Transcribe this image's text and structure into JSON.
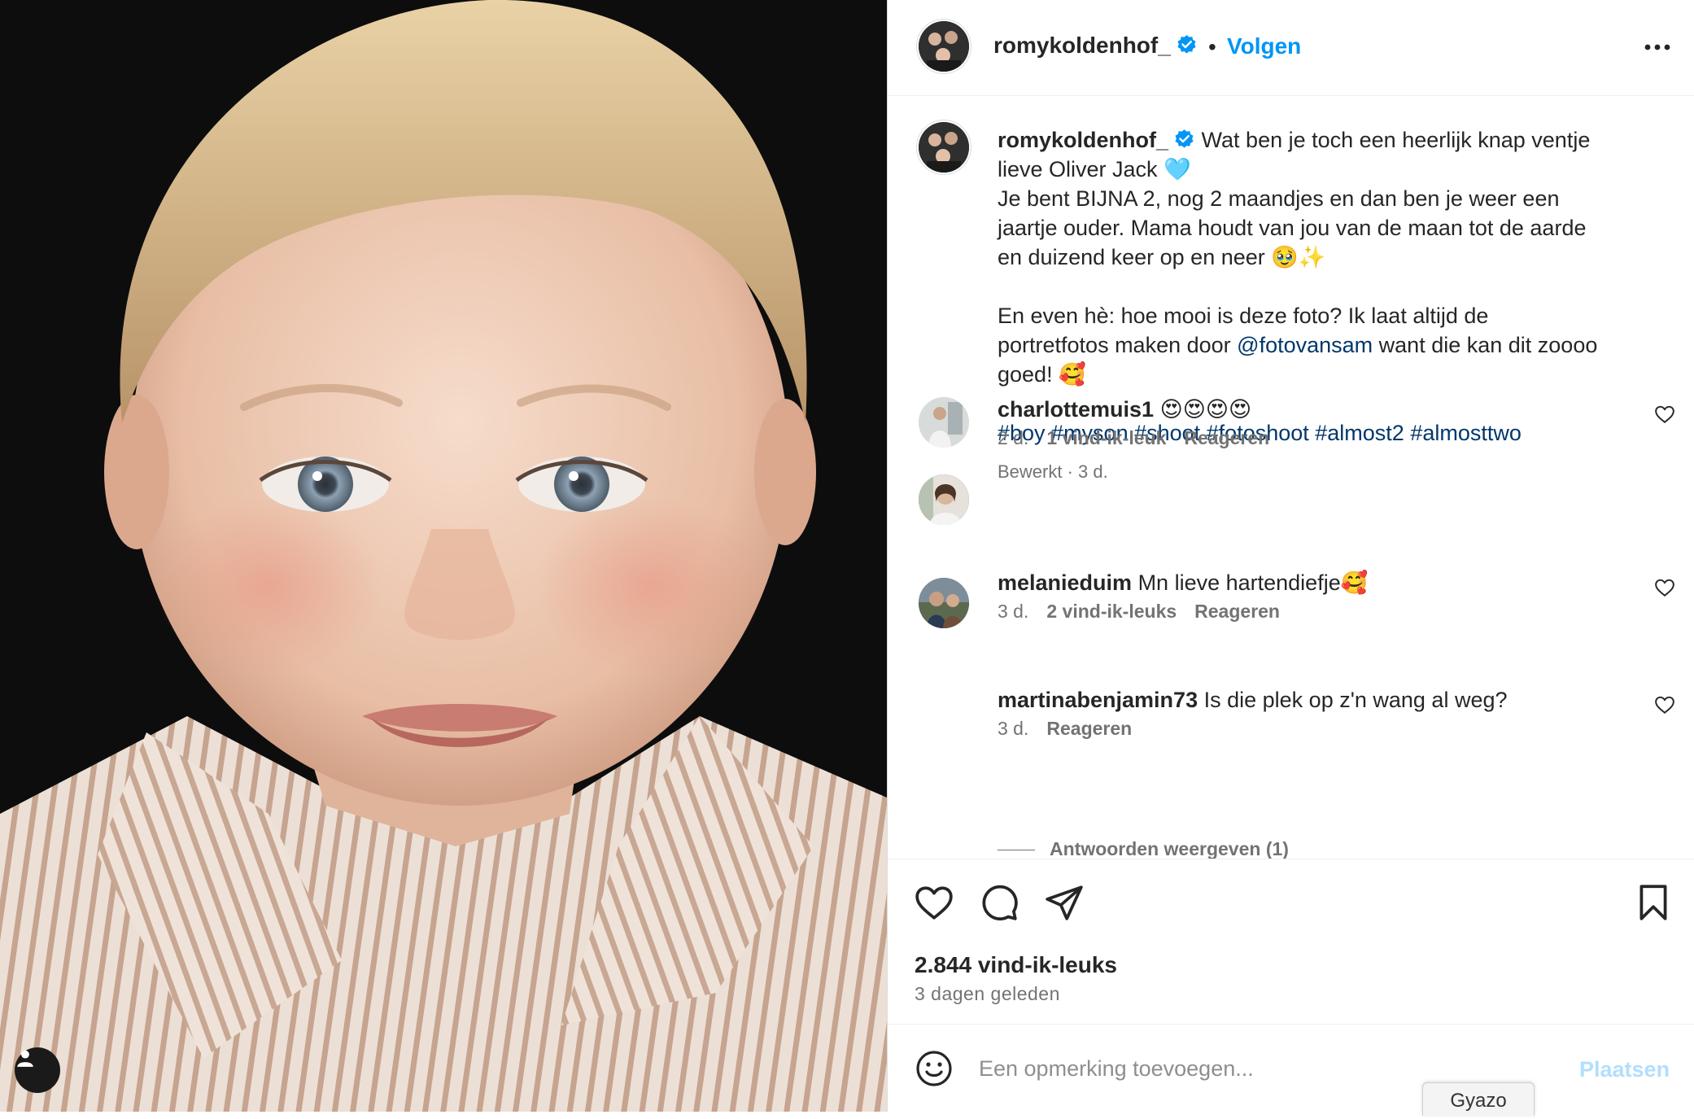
{
  "post": {
    "username": "romykoldenhof_",
    "separator": "•",
    "follow_label": "Volgen",
    "caption": {
      "username": "romykoldenhof_",
      "line1": "Wat ben je toch een heerlijk knap ventje",
      "line2": "lieve Oliver Jack 🩵",
      "line3": "Je bent BIJNA 2, nog 2 maandjes en dan ben je weer een",
      "line4": "jaartje ouder. Mama houdt van jou van de maan tot de aarde",
      "line5": "en duizend keer op en neer 🥹✨",
      "line6": "En even hè: hoe mooi is deze foto? Ik laat altijd de",
      "line7a": "portretfotos maken door",
      "mention": "@fotovansam",
      "line7b": "want die kan dit zoooo",
      "line8": "goed! 🥰",
      "hashtags": "#boy #myson #shoot #fotoshoot #almost2 #almosttwo",
      "meta": "Bewerkt · 3 d."
    },
    "comments": [
      {
        "username": "charlottemuis1",
        "text": "😍😍😍😍",
        "time": "2 d.",
        "likes": "1 vind-ik-leuk",
        "reply": "Reageren"
      },
      {
        "username": "melanieduim",
        "text": "Mn lieve hartendiefje🥰",
        "time": "3 d.",
        "likes": "2 vind-ik-leuks",
        "reply": "Reageren"
      },
      {
        "username": "martinabenjamin73",
        "text": "Is die plek op z'n wang al weg?",
        "time": "3 d.",
        "reply": "Reageren"
      }
    ],
    "show_replies": "Antwoorden weergeven (1)",
    "likes_count": "2.844 vind-ik-leuks",
    "posted": "3 dagen geleden",
    "add_comment_placeholder": "Een opmerking toevoegen...",
    "post_label": "Plaatsen"
  },
  "overlay": {
    "gyazo": "Gyazo"
  },
  "colors": {
    "accent": "#0095f6",
    "link": "#00376b",
    "muted": "#737373"
  },
  "icons": [
    "person-tag-icon",
    "verified-badge-icon",
    "more-options-icon",
    "heart-icon",
    "comment-icon",
    "share-icon",
    "bookmark-icon",
    "emoji-icon"
  ]
}
